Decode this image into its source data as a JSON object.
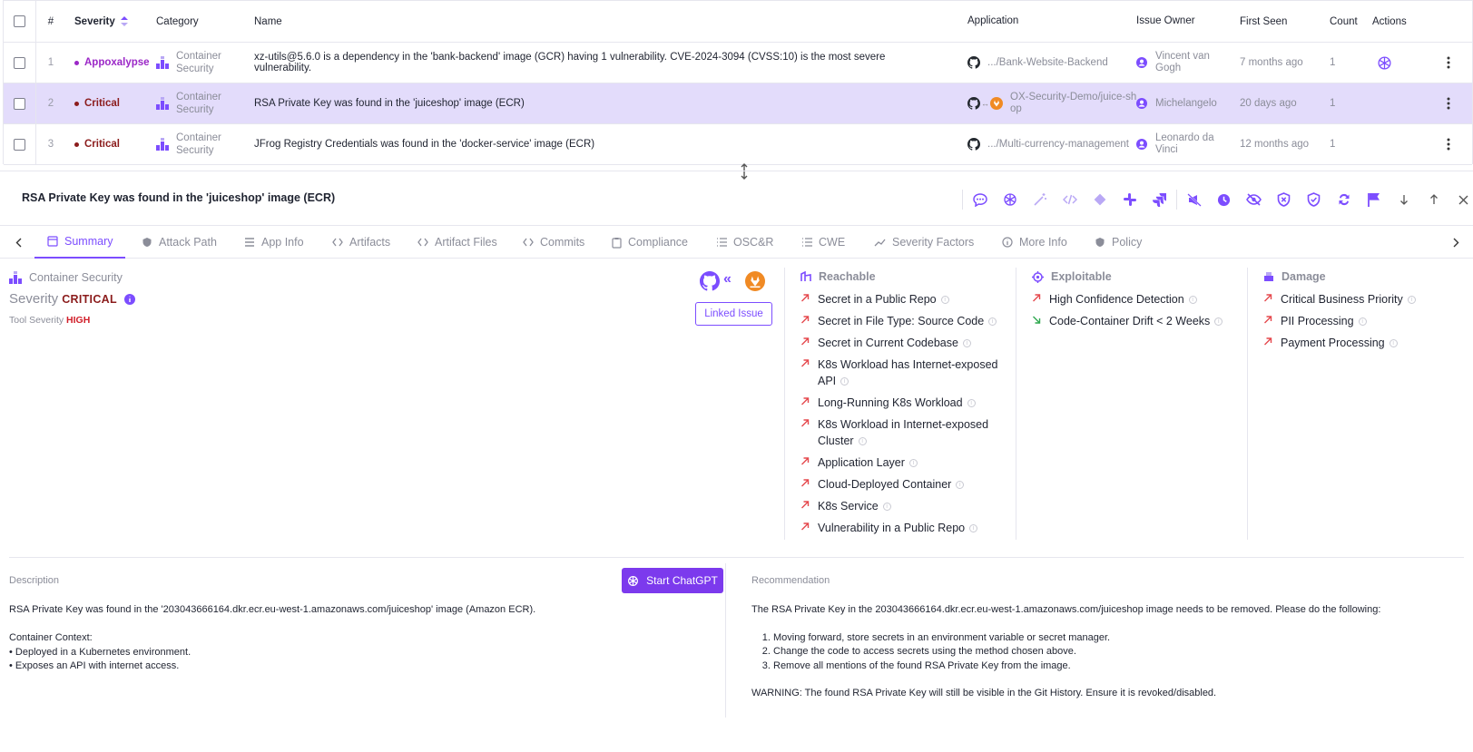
{
  "table": {
    "headers": {
      "num": "#",
      "severity": "Severity",
      "category": "Category",
      "name": "Name",
      "application": "Application",
      "owner": "Issue Owner",
      "first_seen": "First Seen",
      "count": "Count",
      "actions": "Actions"
    },
    "rows": [
      {
        "num": "1",
        "severity": "Appoxalypse",
        "severity_color": "#9b27c7",
        "category_line1": "Container",
        "category_line2": "Security",
        "name": "xz-utils@5.6.0 is a dependency in the 'bank-backend' image (GCR) having 1 vulnerability. CVE-2024-3094 (CVSS:10) is the most severe vulnerability.",
        "app": ".../Bank-Website-Backend",
        "owner_line1": "Vincent van",
        "owner_line2": "Gogh",
        "first_seen": "7 months ago",
        "count": "1"
      },
      {
        "num": "2",
        "severity": "Critical",
        "severity_color": "#8b1c1c",
        "category_line1": "Container",
        "category_line2": "Security",
        "name": "RSA Private Key was found in the 'juiceshop' image (ECR)",
        "app_line1": "OX-Security-Demo/juice-sh",
        "app_line2": "op",
        "owner": "Michelangelo",
        "first_seen": "20 days ago",
        "count": "1"
      },
      {
        "num": "3",
        "severity": "Critical",
        "severity_color": "#8b1c1c",
        "category_line1": "Container",
        "category_line2": "Security",
        "name": "JFrog Registry Credentials was found in the 'docker-service' image (ECR)",
        "app": ".../Multi-currency-management",
        "owner_line1": "Leonardo da",
        "owner_line2": "Vinci",
        "first_seen": "12 months ago",
        "count": "1"
      }
    ]
  },
  "panel": {
    "title": "RSA Private Key was found in the 'juiceshop' image (ECR)",
    "toolbar_icons": [
      "comment-icon",
      "chatgpt-icon",
      "magic-wand-icon",
      "code-icon",
      "git-icon",
      "slack-icon",
      "jira-icon",
      "megaphone-off-icon",
      "clock-icon",
      "eye-off-icon",
      "shield-x-icon",
      "shield-check-icon",
      "sync-icon",
      "flag-icon",
      "arrow-down-icon",
      "arrow-up-icon",
      "close-icon"
    ],
    "tabs": [
      "Summary",
      "Attack Path",
      "App Info",
      "Artifacts",
      "Artifact Files",
      "Commits",
      "Compliance",
      "OSC&R",
      "CWE",
      "Severity Factors",
      "More Info",
      "Policy"
    ],
    "summary": {
      "category": "Container Security",
      "severity_label": "Severity",
      "severity_value": "CRITICAL",
      "tool_severity_label": "Tool Severity",
      "tool_severity_value": "HIGH",
      "linked_issue": "Linked Issue",
      "reachable_title": "Reachable",
      "reachable": [
        "Secret in a Public Repo",
        "Secret in File Type: Source Code",
        "Secret in Current Codebase",
        "K8s Workload has Internet-exposed API",
        "Long-Running K8s Workload",
        "K8s Workload in Internet-exposed Cluster",
        "Application Layer",
        "Cloud-Deployed Container",
        "K8s Service",
        "Vulnerability in a Public Repo"
      ],
      "exploitable_title": "Exploitable",
      "exploitable": [
        "High Confidence Detection",
        "Code-Container Drift < 2 Weeks"
      ],
      "damage_title": "Damage",
      "damage": [
        "Critical Business Priority",
        "PII Processing",
        "Payment Processing"
      ]
    },
    "description": {
      "label": "Description",
      "button": "Start ChatGPT",
      "text": "RSA Private Key was found in the '203043666164.dkr.ecr.eu-west-1.amazonaws.com/juiceshop' image (Amazon ECR).\n\nContainer Context:\n• Deployed in a Kubernetes environment.\n• Exposes an API with internet access."
    },
    "recommendation": {
      "label": "Recommendation",
      "intro": "The RSA Private Key in the 203043666164.dkr.ecr.eu-west-1.amazonaws.com/juiceshop image needs to be removed. Please do the following:",
      "steps": [
        "Moving forward, store secrets in an environment variable or secret manager.",
        "Change the code to access secrets using the method chosen above.",
        "Remove all mentions of the found RSA Private Key from the image."
      ],
      "warning": "WARNING: The found RSA Private Key will still be visible in the Git History. Ensure it is revoked/disabled."
    }
  },
  "colors": {
    "accent": "#7c4dff",
    "selected_row": "#e3dcfb",
    "critical": "#8b1c1c",
    "high": "#d11f2a",
    "arrow_up": "#e5484d",
    "arrow_down": "#2fa84f"
  }
}
